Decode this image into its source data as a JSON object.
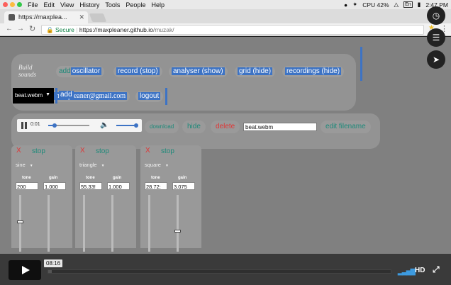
{
  "menubar": {
    "items": [
      "File",
      "Edit",
      "View",
      "History",
      "Tools",
      "People",
      "Help"
    ],
    "cpu": "CPU 42%",
    "lang": "En",
    "clock": "2:47 PM"
  },
  "tab": {
    "title": "https://maxplea..."
  },
  "address": {
    "secure": "Secure",
    "url_host": "https://maxpleaner.github.io",
    "url_path": "/muzak/"
  },
  "build_panel": {
    "label_line1": "Build",
    "label_line2": "sounds",
    "add_prefix": "add",
    "buttons": [
      "oscillator",
      "record (stop)",
      "analyser (show)",
      "grid (hide)",
      "recordings (hide)"
    ],
    "logged_in": "logged in as maxpleaner@gmail.com",
    "logout": "logout"
  },
  "recording_select": {
    "selected": "beat.webm",
    "add": "add"
  },
  "player": {
    "time": "0:01",
    "progress": 0.15,
    "volume": 1.0,
    "download": "download",
    "hide": "hide",
    "delete": "delete",
    "filename": "beat.webm",
    "edit_filename": "edit filename"
  },
  "oscillators": [
    {
      "close": "X",
      "stop": "stop",
      "wave": "sine",
      "tone_label": "tone",
      "gain_label": "gain",
      "tone": "200",
      "gain": "1.000"
    },
    {
      "close": "X",
      "stop": "stop",
      "wave": "triangle",
      "tone_label": "tone",
      "gain_label": "gain",
      "tone": "55.33!",
      "gain": "1.000"
    },
    {
      "close": "X",
      "stop": "stop",
      "wave": "square",
      "tone_label": "tone",
      "gain_label": "gain",
      "tone": "28.72:",
      "gain": "3.075"
    }
  ],
  "video": {
    "tooltip_time": "08:16",
    "hd": "HD",
    "progress": 0.01
  },
  "colors": {
    "page_bg": "#808080",
    "panel_bg": "#939393",
    "highlight": "#3d73c4",
    "teal": "#1e8a7a",
    "delete_red": "#e03535"
  }
}
